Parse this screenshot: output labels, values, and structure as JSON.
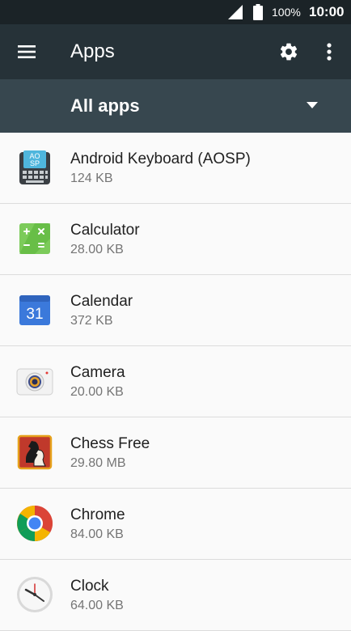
{
  "status_bar": {
    "battery": "100%",
    "time": "10:00"
  },
  "toolbar": {
    "title": "Apps",
    "menu_icon": "hamburger-menu-icon",
    "settings_icon": "gear-icon",
    "overflow_icon": "more-vert-icon"
  },
  "filter": {
    "label": "All apps",
    "icon": "dropdown-triangle-icon"
  },
  "apps": [
    {
      "name": "Android Keyboard (AOSP)",
      "size": "124 KB",
      "icon": "keyboard-icon",
      "icon_text": "AO SP"
    },
    {
      "name": "Calculator",
      "size": "28.00 KB",
      "icon": "calculator-icon"
    },
    {
      "name": "Calendar",
      "size": "372 KB",
      "icon": "calendar-icon",
      "icon_text": "31"
    },
    {
      "name": "Camera",
      "size": "20.00 KB",
      "icon": "camera-icon"
    },
    {
      "name": "Chess Free",
      "size": "29.80 MB",
      "icon": "chess-icon"
    },
    {
      "name": "Chrome",
      "size": "84.00 KB",
      "icon": "chrome-icon"
    },
    {
      "name": "Clock",
      "size": "64.00 KB",
      "icon": "clock-icon"
    }
  ]
}
